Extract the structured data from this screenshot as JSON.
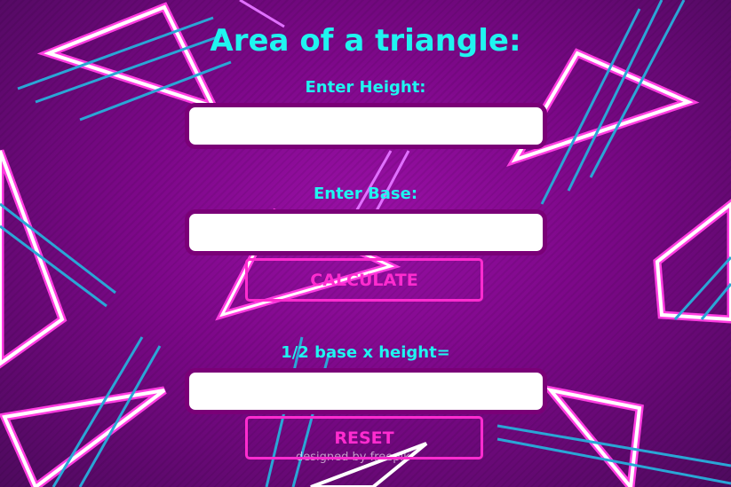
{
  "title": "Area of a triangle:",
  "height_label": "Enter Height:",
  "height_value": "",
  "base_label": "Enter Base:",
  "base_value": "",
  "calculate_label": "CALCULATE",
  "result_label": "1/2 base x height=",
  "result_value": "",
  "reset_label": "RESET",
  "watermark": "designed by freepik",
  "colors": {
    "text": "#1ff5f0",
    "button": "#ff2ccf",
    "input_border": "#7a0077",
    "background": "#7c0888"
  }
}
